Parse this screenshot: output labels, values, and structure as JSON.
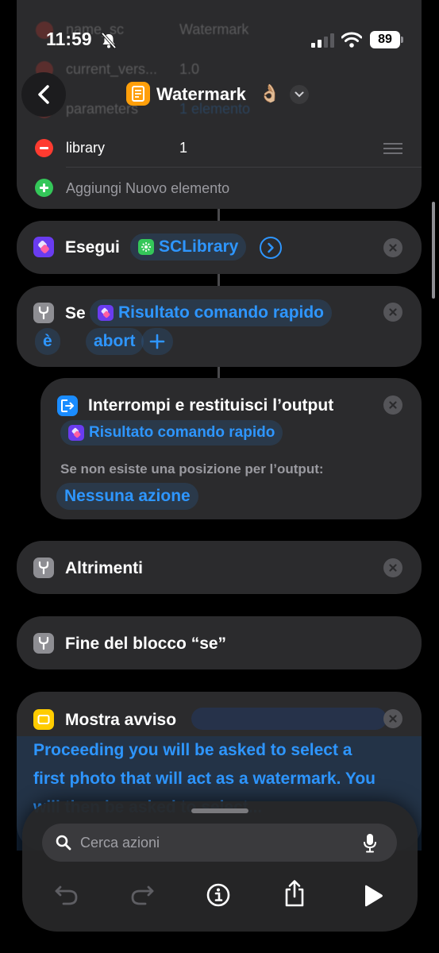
{
  "status_bar": {
    "time": "11:59",
    "battery": "89"
  },
  "header": {
    "title": "Watermark",
    "emoji": "👌🏼"
  },
  "dictionary": {
    "rows": [
      {
        "key": "name_sc",
        "value": "Watermark"
      },
      {
        "key": "current_vers...",
        "value": "1.0"
      },
      {
        "key": "parameters",
        "value": "1 elemento"
      },
      {
        "key": "library",
        "value": "1"
      }
    ],
    "add_label": "Aggiungi Nuovo elemento"
  },
  "run_action": {
    "label": "Esegui",
    "target": "SCLibrary"
  },
  "if_action": {
    "label": "Se",
    "variable": "Risultato comando rapido",
    "operator": "è",
    "value": "abort"
  },
  "stop_action": {
    "label": "Interrompi e restituisci l’output",
    "variable": "Risultato comando rapido",
    "fallback_label": "Se non esiste una posizione per l’output:",
    "fallback_value": "Nessuna azione"
  },
  "else_action": {
    "label": "Altrimenti"
  },
  "end_if_action": {
    "label": "Fine del blocco “se”"
  },
  "alert_action": {
    "label": "Mostra avviso",
    "text_line1": "Proceeding you will be asked to select a",
    "text_line2": "first photo that will act as a watermark. You",
    "text_line3": "will then be asked to select..."
  },
  "search": {
    "placeholder": "Cerca azioni"
  },
  "colors": {
    "accent": "#2e96ff",
    "card": "#2b2b2d",
    "delete": "#ff3b30",
    "add": "#34c759",
    "shortcut": "#6a3cf0",
    "scripting": "#8e8e93",
    "output": "#1a8cff",
    "alert": "#ffcc00"
  }
}
